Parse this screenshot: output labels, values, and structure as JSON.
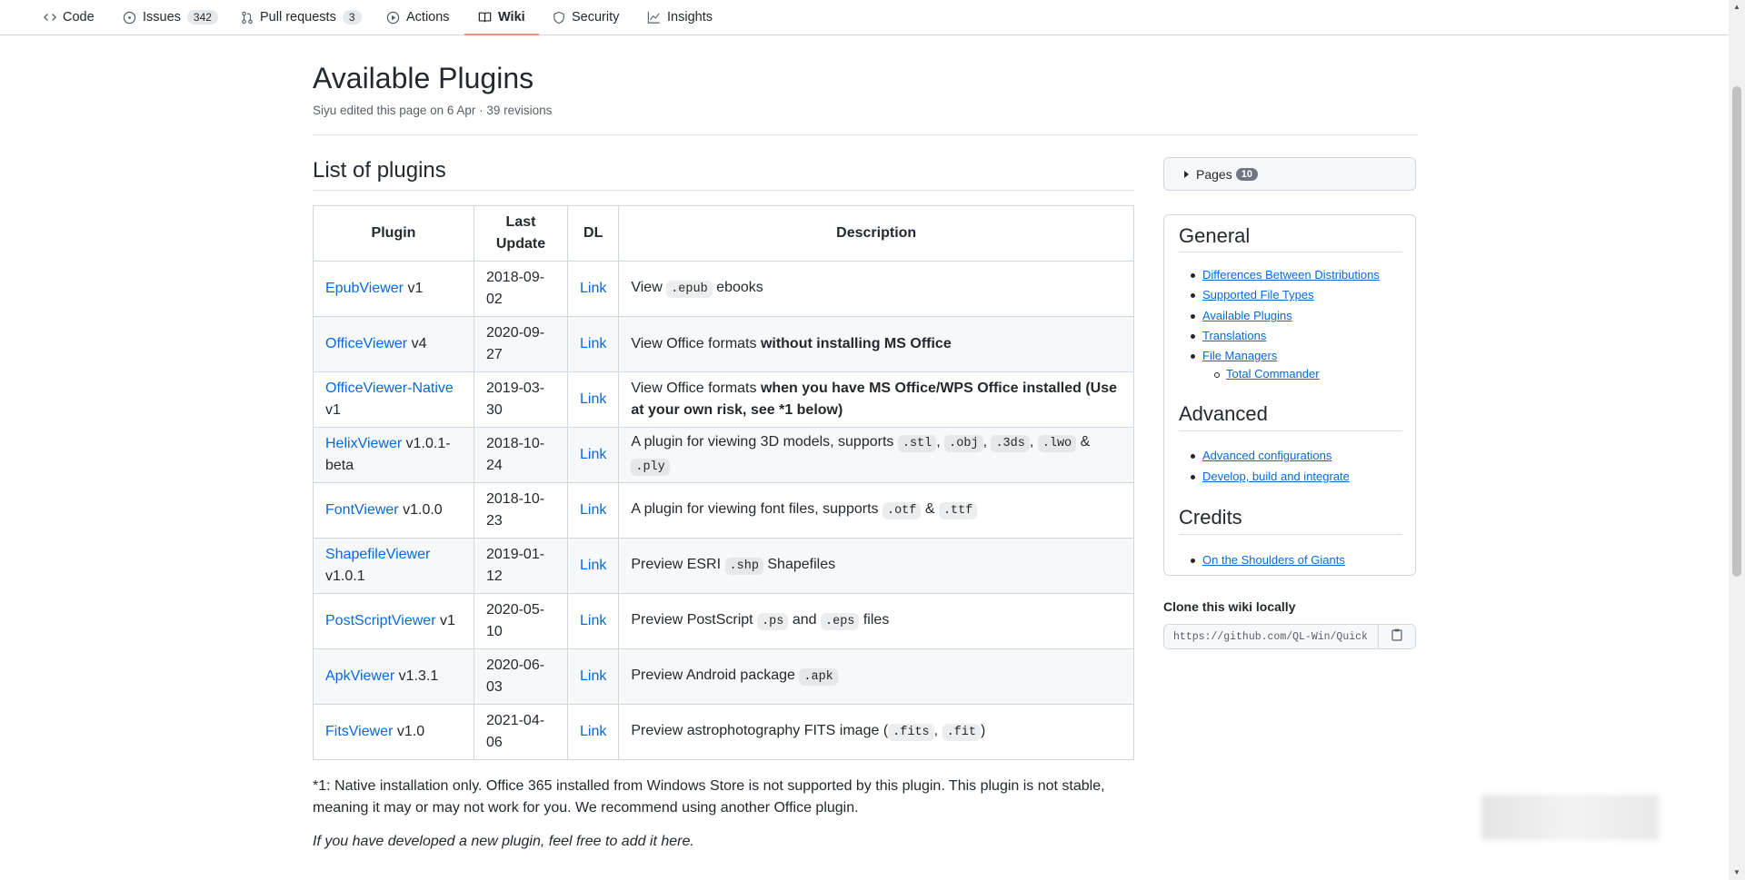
{
  "nav": {
    "code": "Code",
    "issues": "Issues",
    "issues_count": "342",
    "pulls": "Pull requests",
    "pulls_count": "3",
    "actions": "Actions",
    "wiki": "Wiki",
    "security": "Security",
    "insights": "Insights"
  },
  "page": {
    "title": "Available Plugins",
    "meta": "Siyu edited this page on 6 Apr · 39 revisions"
  },
  "main": {
    "heading": "List of plugins",
    "table": {
      "headers": [
        "Plugin",
        "Last Update",
        "DL",
        "Description"
      ],
      "rows": [
        {
          "name": "EpubViewer",
          "version": "v1",
          "date": "2018-09-02",
          "dl": "Link"
        },
        {
          "name": "OfficeViewer",
          "version": "v4",
          "date": "2020-09-27",
          "dl": "Link"
        },
        {
          "name": "OfficeViewer-Native",
          "version": "v1",
          "date": "2019-03-30",
          "dl": "Link"
        },
        {
          "name": "HelixViewer",
          "version": "v1.0.1-beta",
          "date": "2018-10-24",
          "dl": "Link"
        },
        {
          "name": "FontViewer",
          "version": "v1.0.0",
          "date": "2018-10-23",
          "dl": "Link"
        },
        {
          "name": "ShapefileViewer",
          "version": "v1.0.1",
          "date": "2019-01-12",
          "dl": "Link"
        },
        {
          "name": "PostScriptViewer",
          "version": "v1",
          "date": "2020-05-10",
          "dl": "Link"
        },
        {
          "name": "ApkViewer",
          "version": "v1.3.1",
          "date": "2020-06-03",
          "dl": "Link"
        },
        {
          "name": "FitsViewer",
          "version": "v1.0",
          "date": "2021-04-06",
          "dl": "Link"
        }
      ],
      "desc": {
        "r0a": "View",
        "r0code": ".epub",
        "r0b": "ebooks",
        "r1a": "View Office formats",
        "r1b": "without installing MS Office",
        "r2a": "View Office formats",
        "r2b": "when you have MS Office/WPS Office installed (Use at your own risk, see *1 below)",
        "r3a": "A plugin for viewing 3D models, supports",
        "r3c1": ".stl",
        "r3c2": ".obj",
        "r3c3": ".3ds",
        "r3c4": ".lwo",
        "r3amp": "&",
        "r3c5": ".ply",
        "r4a": "A plugin for viewing font files, supports",
        "r4c1": ".otf",
        "r4amp": "&",
        "r4c2": ".ttf",
        "r5a": "Preview ESRI",
        "r5code": ".shp",
        "r5b": "Shapefiles",
        "r6a": "Preview PostScript",
        "r6c1": ".ps",
        "r6and": "and",
        "r6c2": ".eps",
        "r6b": "files",
        "r7a": "Preview Android package",
        "r7code": ".apk",
        "r8a": "Preview astrophotography FITS image (",
        "r8c1": ".fits",
        "r8c2": ".fit",
        "r8b": ")"
      }
    },
    "footnote": "*1: Native installation only. Office 365 installed from Windows Store is not supported by this plugin. This plugin is not stable, meaning it may or may not work for you. We recommend using another Office plugin.",
    "note": "If you have developed a new plugin, feel free to add it here."
  },
  "sidebar": {
    "pages_label": "Pages",
    "pages_count": "10",
    "general": "General",
    "general_items": [
      "Differences Between Distributions",
      "Supported File Types",
      "Available Plugins",
      "Translations",
      "File Managers"
    ],
    "general_sub": "Total Commander",
    "advanced": "Advanced",
    "advanced_items": [
      "Advanced configurations",
      "Develop, build and integrate"
    ],
    "credits": "Credits",
    "credits_items": [
      "On the Shoulders of Giants"
    ],
    "clone_label": "Clone this wiki locally",
    "clone_url": "https://github.com/QL-Win/QuickLook.wiki.git"
  },
  "colors": {
    "link": "#0969da",
    "active_tab": "#fd8c73",
    "border": "#d0d7de"
  }
}
